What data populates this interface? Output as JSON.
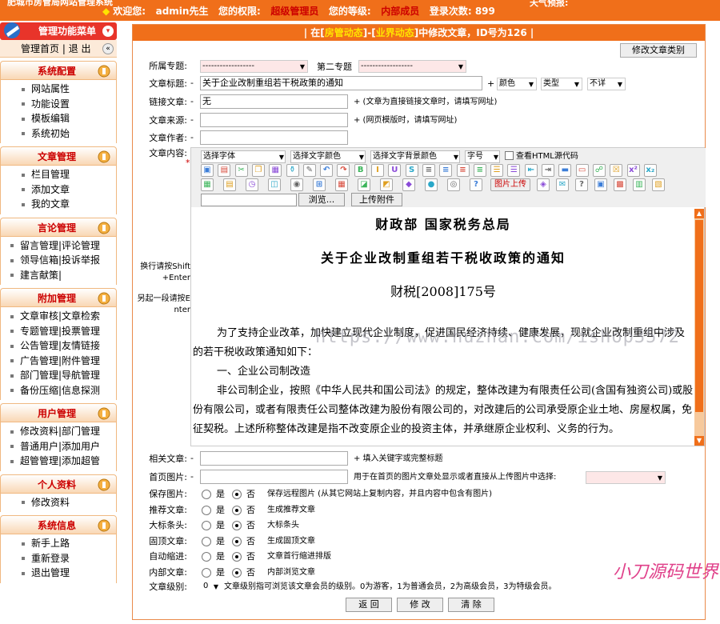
{
  "topbar": {
    "site_title": "肥城市房管局网站管理系统",
    "welcome_label": "欢迎您:",
    "user": "admin先生",
    "perm_label": "您的权限:",
    "perm": "超级管理员",
    "level_label": "您的等级:",
    "level": "内部成员",
    "login_count": "登录次数: 899",
    "weather": "天气预报:"
  },
  "sidebar": {
    "header": "管理功能菜单",
    "home": "管理首页",
    "sep": "|",
    "logout": "退 出",
    "sections": [
      {
        "title": "系统配置",
        "items": [
          "网站属性",
          "功能设置",
          "模板编辑",
          "系统初始"
        ]
      },
      {
        "title": "文章管理",
        "items": [
          "栏目管理",
          "添加文章",
          "我的文章"
        ]
      },
      {
        "title": "言论管理",
        "items": [
          "留言管理|评论管理",
          "领导信箱|投诉举报",
          "建言献策|"
        ]
      },
      {
        "title": "附加管理",
        "items": [
          "文章审核|文章检索",
          "专题管理|投票管理",
          "公告管理|友情链接",
          "广告管理|附件管理",
          "部门管理|导航管理",
          "备份压缩|信息探测"
        ]
      },
      {
        "title": "用户管理",
        "items": [
          "修改资料|部门管理",
          "普通用户|添加用户",
          "超管管理|添加超管"
        ]
      },
      {
        "title": "个人资料",
        "items": [
          "修改资料"
        ]
      },
      {
        "title": "系统信息",
        "items": [
          "新手上路",
          "重新登录",
          "退出管理"
        ]
      }
    ]
  },
  "caption": {
    "pre": "| 在[",
    "a": "房管动态",
    "mid": "]-[",
    "b": "业界动态",
    "post": "]中修改文章，ID号为126 |"
  },
  "category_button": "修改文章类别",
  "form": {
    "topic_label": "所属专题:",
    "topic_value": "------------------",
    "topic2_label": "第二专题",
    "topic2_value": "------------------",
    "title_label": "文章标题:",
    "title_value": "关于企业改制重组若干税政策的通知",
    "color_value": "颜色",
    "type_value": "类型",
    "detail_value": "不详",
    "link_label": "链接文章:",
    "link_value": "无",
    "link_hint": "+ (文章为直接链接文章时，请填写网址)",
    "source_label": "文章来源:",
    "source_hint": "+ (网页模版时，请填写网址)",
    "author_label": "文章作者:",
    "content_label": "文章内容:",
    "newline_hint": "换行请按Shift+Enter",
    "para_hint": "另起一段请按Enter",
    "required_mark": "*",
    "dash": "-",
    "plus": "+"
  },
  "editor": {
    "font_select": "选择字体",
    "color_select": "选择文字颜色",
    "bg_select": "选择文字背景颜色",
    "size_select": "字号",
    "source_check": "查看HTML源代码",
    "image_upload": "图片上传",
    "browse": "浏览...",
    "upload_attach": "上传附件",
    "doc_line1": "财政部  国家税务总局",
    "doc_line2": "关于企业改制重组若干税收政策的通知",
    "doc_line3": "财税[2008]175号",
    "doc_p1": "为了支持企业改革，加快建立现代企业制度，促进国民经济持续、健康发展，现就企业改制重组中涉及的若干税收政策通知如下：",
    "doc_p2": "一、企业公司制改造",
    "doc_p3": "非公司制企业，按照《中华人民共和国公司法》的规定，整体改建为有限责任公司(含国有独资公司)或股份有限公司，或者有限责任公司整体改建为股份有限公司的，对改建后的公司承受原企业土地、房屋权属，免征契税。上述所称整体改建是指不改变原企业的投资主体，并承继原企业权利、义务的行为。"
  },
  "watermark": "https://www.huzhan.com/ishop3572",
  "watermark2": "小刀源码世界",
  "lower": {
    "related_label": "相关文章:",
    "related_hint": "+ 填入关键字或完整标题",
    "homeimg_label": "首页图片:",
    "homeimg_hint": "用于在首页的图片文章处显示或者直接从上传图片中选择:",
    "save_label": "保存图片:",
    "save_yes": "是",
    "save_no": "否",
    "save_hint": "保存远程图片  (从其它网站上复制内容，并且内容中包含有图片)",
    "rec_label": "推荐文章:",
    "rec_hint": "生成推荐文章",
    "banner_label": "大标条头:",
    "banner_hint": "大标条头",
    "fixed_label": "固顶文章:",
    "fixed_hint": "生成固顶文章",
    "indent_label": "自动缩进:",
    "indent_hint": "文章首行缩进排版",
    "internal_label": "内部文章:",
    "internal_hint": "内部浏览文章",
    "grade_label": "文章级别:",
    "grade_value": "0",
    "grade_hint": "文章级别指可浏览该文章会员的级别。0为游客，1为普通会员，2为高级会员，3为特级会员。",
    "yes": "是",
    "no": "否"
  },
  "buttons": {
    "back": "返 回",
    "modify": "修 改",
    "clear": "清 除"
  },
  "colors": {
    "orange": "#f06f1a",
    "red": "#e8342a",
    "yellow": "#ffe400"
  }
}
